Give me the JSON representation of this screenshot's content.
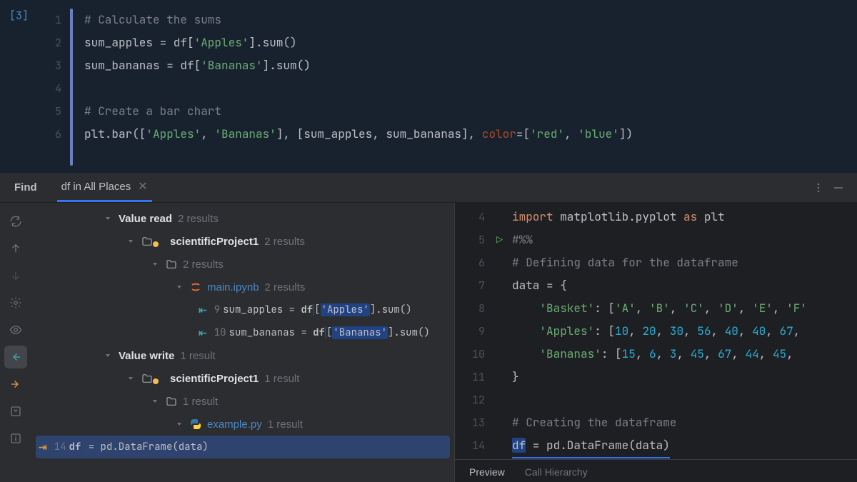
{
  "cell": {
    "prompt": "[3]",
    "lines": [
      {
        "n": 1,
        "tokens": [
          [
            "comment",
            "# Calculate the sums"
          ]
        ]
      },
      {
        "n": 2,
        "tokens": [
          [
            "ident",
            "sum_apples = df["
          ],
          [
            "string",
            "'Apples'"
          ],
          [
            "ident",
            "].sum()"
          ]
        ]
      },
      {
        "n": 3,
        "tokens": [
          [
            "ident",
            "sum_bananas = df["
          ],
          [
            "string",
            "'Bananas'"
          ],
          [
            "ident",
            "].sum()"
          ]
        ]
      },
      {
        "n": 4,
        "tokens": []
      },
      {
        "n": 5,
        "tokens": [
          [
            "comment",
            "# Create a bar chart"
          ]
        ]
      },
      {
        "n": 6,
        "tokens": [
          [
            "ident",
            "plt.bar(["
          ],
          [
            "string",
            "'Apples'"
          ],
          [
            "ident",
            ", "
          ],
          [
            "string",
            "'Bananas'"
          ],
          [
            "ident",
            "], [sum_apples, sum_bananas], "
          ],
          [
            "kwarg",
            "color"
          ],
          [
            "ident",
            "=["
          ],
          [
            "string",
            "'red'"
          ],
          [
            "ident",
            ", "
          ],
          [
            "string",
            "'blue'"
          ],
          [
            "ident",
            "])"
          ]
        ]
      }
    ]
  },
  "find": {
    "title": "Find",
    "tab_label": "df in All Places",
    "groups": [
      {
        "label": "Value read",
        "count": "2 results",
        "project": {
          "name": "scientificProject1",
          "count": "2 results"
        },
        "folder_count": "2 results",
        "file": {
          "name": "main.ipynb",
          "count": "2 results",
          "icon": "jupyter"
        },
        "rows": [
          {
            "ln": "9",
            "code_before": "sum_apples = ",
            "df": "df",
            "code_after": "['Apples'].sum()",
            "kind": "read"
          },
          {
            "ln": "10",
            "code_before": "sum_bananas = ",
            "df": "df",
            "code_after": "['Bananas'].sum()",
            "kind": "read"
          }
        ]
      },
      {
        "label": "Value write",
        "count": "1 result",
        "project": {
          "name": "scientificProject1",
          "count": "1 result"
        },
        "folder_count": "1 result",
        "file": {
          "name": "example.py",
          "count": "1 result",
          "icon": "python"
        },
        "rows": [
          {
            "ln": "14",
            "code_before": "",
            "df": "df",
            "code_after": " = pd.DataFrame(data)",
            "kind": "write",
            "selected": true
          }
        ]
      }
    ]
  },
  "preview": {
    "lines": [
      {
        "n": 4,
        "tokens": [
          [
            "keyword",
            "import "
          ],
          [
            "ident",
            "matplotlib.pyplot "
          ],
          [
            "keyword",
            "as "
          ],
          [
            "ident",
            "plt"
          ]
        ]
      },
      {
        "n": 5,
        "play": true,
        "tokens": [
          [
            "comment",
            "#%%"
          ]
        ]
      },
      {
        "n": 6,
        "tokens": [
          [
            "comment",
            "# Defining data for the dataframe"
          ]
        ]
      },
      {
        "n": 7,
        "tokens": [
          [
            "ident",
            "data = {"
          ]
        ]
      },
      {
        "n": 8,
        "tokens": [
          [
            "ident",
            "    "
          ],
          [
            "string",
            "'Basket'"
          ],
          [
            "ident",
            ": ["
          ],
          [
            "string",
            "'A'"
          ],
          [
            "ident",
            ", "
          ],
          [
            "string",
            "'B'"
          ],
          [
            "ident",
            ", "
          ],
          [
            "string",
            "'C'"
          ],
          [
            "ident",
            ", "
          ],
          [
            "string",
            "'D'"
          ],
          [
            "ident",
            ", "
          ],
          [
            "string",
            "'E'"
          ],
          [
            "ident",
            ", "
          ],
          [
            "string",
            "'F'"
          ]
        ]
      },
      {
        "n": 9,
        "tokens": [
          [
            "ident",
            "    "
          ],
          [
            "string",
            "'Apples'"
          ],
          [
            "ident",
            ": ["
          ],
          [
            "num",
            "10"
          ],
          [
            "ident",
            ", "
          ],
          [
            "num",
            "20"
          ],
          [
            "ident",
            ", "
          ],
          [
            "num",
            "30"
          ],
          [
            "ident",
            ", "
          ],
          [
            "num",
            "56"
          ],
          [
            "ident",
            ", "
          ],
          [
            "num",
            "40"
          ],
          [
            "ident",
            ", "
          ],
          [
            "num",
            "40"
          ],
          [
            "ident",
            ", "
          ],
          [
            "num",
            "67"
          ],
          [
            "ident",
            ","
          ]
        ]
      },
      {
        "n": 10,
        "tokens": [
          [
            "ident",
            "    "
          ],
          [
            "string",
            "'Bananas'"
          ],
          [
            "ident",
            ": ["
          ],
          [
            "num",
            "15"
          ],
          [
            "ident",
            ", "
          ],
          [
            "num",
            "6"
          ],
          [
            "ident",
            ", "
          ],
          [
            "num",
            "3"
          ],
          [
            "ident",
            ", "
          ],
          [
            "num",
            "45"
          ],
          [
            "ident",
            ", "
          ],
          [
            "num",
            "67"
          ],
          [
            "ident",
            ", "
          ],
          [
            "num",
            "44"
          ],
          [
            "ident",
            ", "
          ],
          [
            "num",
            "45"
          ],
          [
            "ident",
            ", "
          ]
        ]
      },
      {
        "n": 11,
        "tokens": [
          [
            "ident",
            "}"
          ]
        ]
      },
      {
        "n": 12,
        "tokens": []
      },
      {
        "n": 13,
        "tokens": [
          [
            "comment",
            "# Creating the dataframe"
          ]
        ]
      },
      {
        "n": 14,
        "tokens": [
          [
            "hl",
            "df"
          ],
          [
            "ident",
            " = pd.DataFrame(data)"
          ]
        ],
        "underline": true
      }
    ],
    "tabs": {
      "preview": "Preview",
      "call_hierarchy": "Call Hierarchy"
    }
  }
}
